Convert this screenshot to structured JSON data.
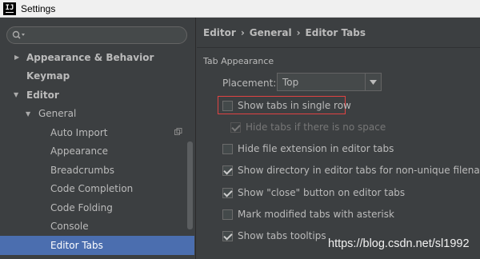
{
  "window": {
    "title": "Settings",
    "app_icon_text": "IJ"
  },
  "search": {
    "placeholder": "",
    "icon": "search-icon"
  },
  "tree": {
    "items": [
      {
        "label": "Appearance & Behavior",
        "bold": true,
        "arrow": "collapsed",
        "indent": 0
      },
      {
        "label": "Keymap",
        "bold": true,
        "arrow": "none",
        "indent": 0
      },
      {
        "label": "Editor",
        "bold": true,
        "arrow": "expanded",
        "indent": 0
      },
      {
        "label": "General",
        "bold": false,
        "arrow": "expanded",
        "indent": 1
      },
      {
        "label": "Auto Import",
        "bold": false,
        "arrow": "none",
        "indent": 2,
        "project_icon": true
      },
      {
        "label": "Appearance",
        "bold": false,
        "arrow": "none",
        "indent": 2
      },
      {
        "label": "Breadcrumbs",
        "bold": false,
        "arrow": "none",
        "indent": 2
      },
      {
        "label": "Code Completion",
        "bold": false,
        "arrow": "none",
        "indent": 2
      },
      {
        "label": "Code Folding",
        "bold": false,
        "arrow": "none",
        "indent": 2
      },
      {
        "label": "Console",
        "bold": false,
        "arrow": "none",
        "indent": 2
      },
      {
        "label": "Editor Tabs",
        "bold": false,
        "arrow": "none",
        "indent": 2,
        "selected": true
      }
    ]
  },
  "breadcrumb": {
    "items": [
      "Editor",
      "General",
      "Editor Tabs"
    ],
    "separator": "›"
  },
  "section": {
    "label": "Tab Appearance"
  },
  "placement": {
    "label": "Placement:",
    "value": "Top"
  },
  "options": [
    {
      "label": "Show tabs in single row",
      "checked": false,
      "disabled": false,
      "highlighted": true
    },
    {
      "label": "Hide tabs if there is no space",
      "checked": true,
      "disabled": true
    },
    {
      "label": "Hide file extension in editor tabs",
      "checked": false,
      "disabled": false
    },
    {
      "label": "Show directory in editor tabs for non-unique filenames",
      "checked": true,
      "disabled": false
    },
    {
      "label": "Show \"close\" button on editor tabs",
      "checked": true,
      "disabled": false
    },
    {
      "label": "Mark modified tabs with asterisk",
      "checked": false,
      "disabled": false
    },
    {
      "label": "Show tabs tooltips",
      "checked": true,
      "disabled": false
    }
  ],
  "watermark": {
    "text": "https://blog.csdn.net/sl1992"
  },
  "colors": {
    "background": "#3c3f41",
    "selection": "#4b6eaf",
    "highlight_border": "#e04343",
    "text": "#bbbbbb"
  }
}
